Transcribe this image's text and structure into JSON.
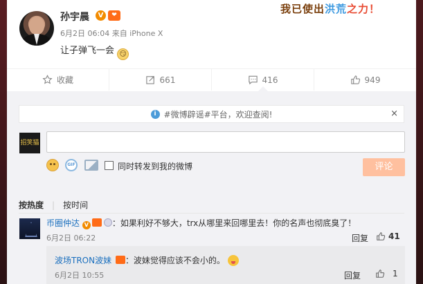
{
  "post": {
    "author_name": "孙宇晨",
    "verified_badge": "V",
    "level_badge": "❤",
    "timestamp": "6月2日 06:04",
    "source_prefix": "来自",
    "source": "iPhone X",
    "text": "让子弹飞一会",
    "emoji": "😏"
  },
  "banner": {
    "part1": "我已使出",
    "hot": "洪荒",
    "part2": "之力！"
  },
  "actions": [
    {
      "icon": "star-icon",
      "label": "收藏"
    },
    {
      "icon": "repost-icon",
      "label": "661"
    },
    {
      "icon": "comment-icon",
      "label": "416"
    },
    {
      "icon": "like-icon",
      "label": "949"
    }
  ],
  "notice": {
    "text": "#微博辟谣#平台，欢迎查阅!",
    "close": "×"
  },
  "composer": {
    "my_avatar_text": "招笑猫",
    "input_value": "",
    "gif_label": "GIF",
    "repost_label": "同时转发到我的微博",
    "submit_label": "评论"
  },
  "sort": {
    "hot": "按热度",
    "time": "按时间",
    "separator": "|"
  },
  "comments": [
    {
      "author": "币圈仲达",
      "text": "：如果利好不够大，trx从哪里来回哪里去！你的名声也彻底臭了！",
      "time": "6月2日 06:22",
      "reply_label": "回复",
      "likes": "41",
      "sub_reply": {
        "author": "波场TRON波妹",
        "text": "：波妹觉得应该不会小的。",
        "time": "6月2日 10:55",
        "reply_label": "回复",
        "likes": "1"
      }
    }
  ],
  "colors": {
    "link": "#1a6fbe",
    "accent_orange": "#ff8140",
    "submit_disabled": "#ffc09f",
    "comment_bg": "#f2f2f5"
  }
}
